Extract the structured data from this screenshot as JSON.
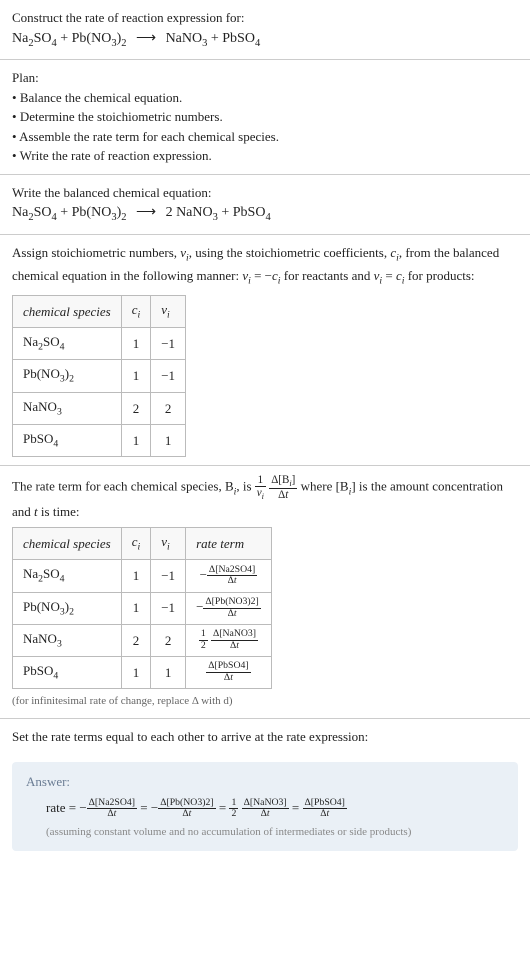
{
  "prompt": {
    "title": "Construct the rate of reaction expression for:",
    "equation_lhs1": "Na",
    "equation_lhs1_sub1": "2",
    "equation_lhs1b": "SO",
    "equation_lhs1_sub2": "4",
    "plus1": " + ",
    "equation_lhs2": "Pb(NO",
    "equation_lhs2_sub": "3",
    "equation_lhs2b": ")",
    "equation_lhs2_sub2": "2",
    "arrow": "⟶",
    "equation_rhs1": "NaNO",
    "equation_rhs1_sub": "3",
    "plus2": " + ",
    "equation_rhs2": "PbSO",
    "equation_rhs2_sub": "4"
  },
  "plan": {
    "title": "Plan:",
    "items": [
      "Balance the chemical equation.",
      "Determine the stoichiometric numbers.",
      "Assemble the rate term for each chemical species.",
      "Write the rate of reaction expression."
    ]
  },
  "balanced": {
    "title": "Write the balanced chemical equation:",
    "coef_rhs1": "2 "
  },
  "assign": {
    "text1": "Assign stoichiometric numbers, ",
    "nu": "ν",
    "sub_i": "i",
    "text2": ", using the stoichiometric coefficients, ",
    "c": "c",
    "text3": ", from the balanced chemical equation in the following manner: ",
    "eq1": " = −",
    "text4": " for reactants and ",
    "eq2": " = ",
    "text5": " for products:"
  },
  "table1": {
    "headers": [
      "chemical species",
      "cᵢ",
      "νᵢ"
    ],
    "rows": [
      {
        "species": "Na₂SO₄",
        "c": "1",
        "nu": "−1"
      },
      {
        "species": "Pb(NO₃)₂",
        "c": "1",
        "nu": "−1"
      },
      {
        "species": "NaNO₃",
        "c": "2",
        "nu": "2"
      },
      {
        "species": "PbSO₄",
        "c": "1",
        "nu": "1"
      }
    ]
  },
  "rateterm_text": {
    "p1": "The rate term for each chemical species, B",
    "p2": ", is ",
    "p3": " where [B",
    "p4": "] is the amount concentration and ",
    "t": "t",
    "p5": " is time:"
  },
  "table2": {
    "headers": [
      "chemical species",
      "cᵢ",
      "νᵢ",
      "rate term"
    ],
    "rows": [
      {
        "species": "Na₂SO₄",
        "c": "1",
        "nu": "−1",
        "neg": "−",
        "num": "Δ[Na2SO4]",
        "den": "Δt",
        "coef": ""
      },
      {
        "species": "Pb(NO₃)₂",
        "c": "1",
        "nu": "−1",
        "neg": "−",
        "num": "Δ[Pb(NO3)2]",
        "den": "Δt",
        "coef": ""
      },
      {
        "species": "NaNO₃",
        "c": "2",
        "nu": "2",
        "neg": "",
        "num": "Δ[NaNO3]",
        "den": "Δt",
        "coef_num": "1",
        "coef_den": "2"
      },
      {
        "species": "PbSO₄",
        "c": "1",
        "nu": "1",
        "neg": "",
        "num": "Δ[PbSO4]",
        "den": "Δt",
        "coef": ""
      }
    ],
    "note": "(for infinitesimal rate of change, replace Δ with d)"
  },
  "setequal": "Set the rate terms equal to each other to arrive at the rate expression:",
  "answer": {
    "label": "Answer:",
    "rate": "rate = ",
    "eq": " = ",
    "terms": [
      {
        "neg": "−",
        "num": "Δ[Na2SO4]",
        "den": "Δt"
      },
      {
        "neg": "−",
        "num": "Δ[Pb(NO3)2]",
        "den": "Δt"
      },
      {
        "coef_num": "1",
        "coef_den": "2",
        "num": "Δ[NaNO3]",
        "den": "Δt"
      },
      {
        "num": "Δ[PbSO4]",
        "den": "Δt"
      }
    ],
    "assume": "(assuming constant volume and no accumulation of intermediates or side products)"
  },
  "frac_generic": {
    "one": "1",
    "nu_i": "νᵢ",
    "dBi": "Δ[Bᵢ]",
    "dt": "Δt"
  }
}
